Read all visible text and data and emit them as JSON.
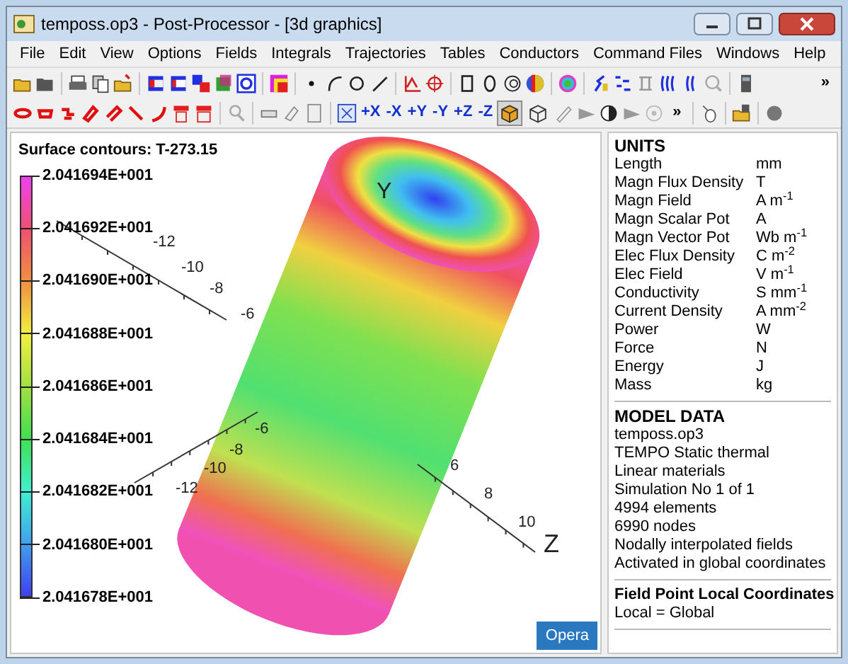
{
  "window": {
    "title": "temposs.op3 - Post-Processor - [3d graphics]"
  },
  "menu": [
    "File",
    "Edit",
    "View",
    "Options",
    "Fields",
    "Integrals",
    "Trajectories",
    "Tables",
    "Conductors",
    "Command Files",
    "Windows",
    "Help"
  ],
  "toolbar_overflow": [
    "»",
    "»"
  ],
  "view_axes": [
    "+X",
    "-X",
    "+Y",
    "-Y",
    "+Z",
    "-Z"
  ],
  "view_modes": [
    {
      "selected": true
    },
    {
      "selected": false
    }
  ],
  "legend": {
    "title": "Surface contours: T-273.15",
    "labels": [
      "2.041694E+001",
      "2.041692E+001",
      "2.041690E+001",
      "2.041688E+001",
      "2.041686E+001",
      "2.041684E+001",
      "2.041682E+001",
      "2.041680E+001",
      "2.041678E+001"
    ]
  },
  "axes": [
    {
      "ticks": [
        "-12",
        "-10",
        "-8",
        "-6"
      ]
    },
    {
      "ticks": [
        "-12",
        "-10",
        "-8",
        "-6"
      ]
    },
    {
      "ticks": [
        "6",
        "8",
        "10"
      ],
      "label": "Z"
    }
  ],
  "y_label": "Y",
  "opera_button": "Opera",
  "units": {
    "title": "UNITS",
    "rows": [
      {
        "name": "Length",
        "unit": "mm"
      },
      {
        "name": "Magn Flux Density",
        "unit": "T"
      },
      {
        "name": "Magn Field",
        "unit": "A m$^{-1}$"
      },
      {
        "name": "Magn Scalar Pot",
        "unit": "A"
      },
      {
        "name": "Magn Vector Pot",
        "unit": "Wb m$^{-1}$"
      },
      {
        "name": "Elec Flux Density",
        "unit": "C m$^{-2}$"
      },
      {
        "name": "Elec Field",
        "unit": "V m$^{-1}$"
      },
      {
        "name": "Conductivity",
        "unit": "S mm$^{-1}$"
      },
      {
        "name": "Current Density",
        "unit": "A mm$^{-2}$"
      },
      {
        "name": "Power",
        "unit": "W"
      },
      {
        "name": "Force",
        "unit": "N"
      },
      {
        "name": "Energy",
        "unit": "J"
      },
      {
        "name": "Mass",
        "unit": "kg"
      }
    ]
  },
  "model_data": {
    "title": "MODEL DATA",
    "lines": [
      "temposs.op3",
      "TEMPO Static thermal",
      "Linear materials",
      "Simulation No 1 of 1",
      "4994 elements",
      "6990 nodes",
      "Nodally interpolated fields",
      "Activated in global coordinates"
    ]
  },
  "field_point": {
    "title": "Field Point Local Coordinates",
    "lines": [
      "Local = Global"
    ]
  }
}
